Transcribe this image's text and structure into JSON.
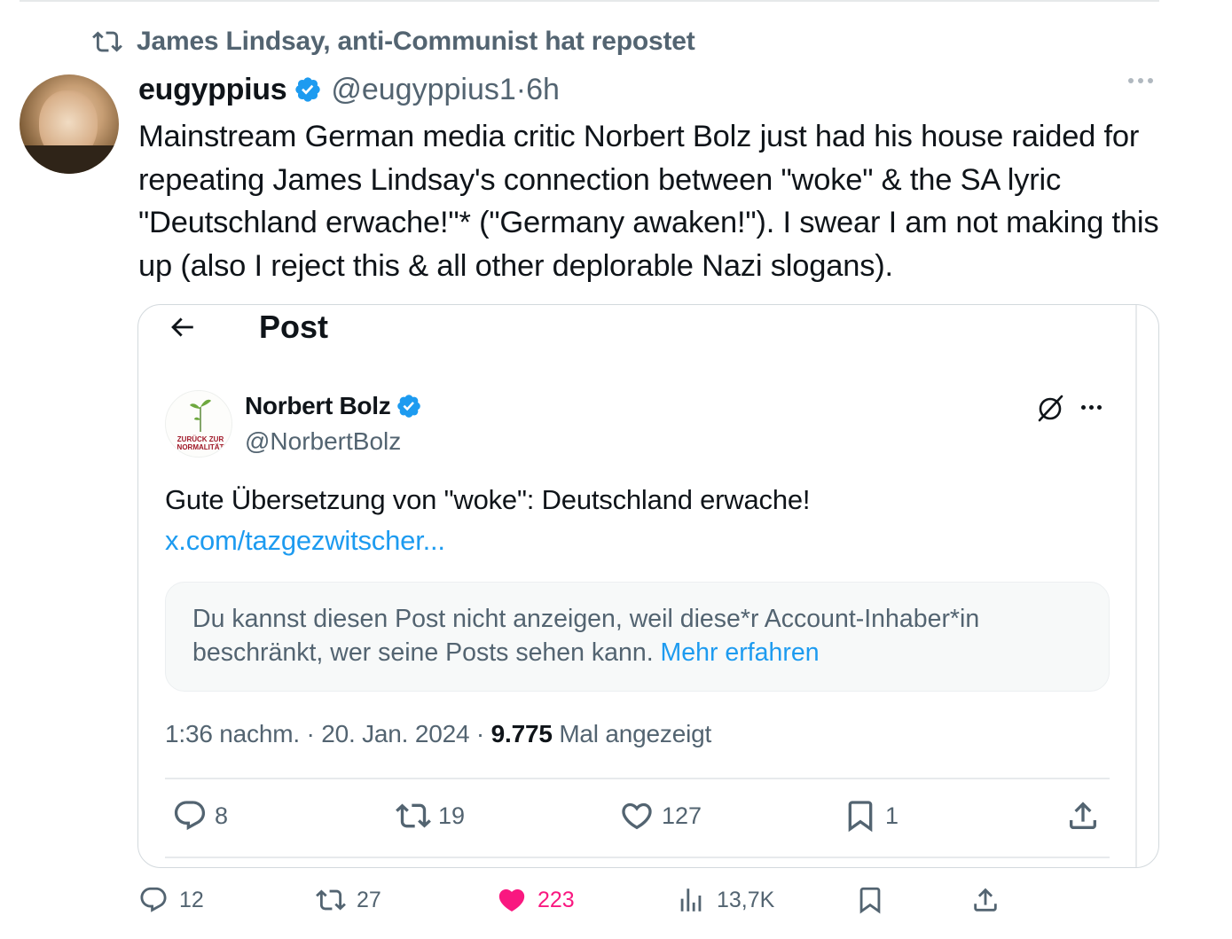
{
  "repost": {
    "label": "James Lindsay, anti-Communist hat repostet"
  },
  "author": {
    "name": "eugyppius",
    "handle": "@eugyppius1",
    "time": "6h"
  },
  "tweet": {
    "text": "Mainstream German media critic Norbert Bolz just had his house raided for repeating James Lindsay's connection between \"woke\" & the SA lyric \"Deutschland erwache!\"* (\"Germany awaken!\"). I swear I am not making this up (also I reject this & all other deplorable Nazi slogans)."
  },
  "quoted": {
    "screen_title": "Post",
    "name": "Norbert Bolz",
    "handle": "@NorbertBolz",
    "avatar_text": "ZURÜCK ZUR NORMALITÄT",
    "text": "Gute Übersetzung von \"woke\": Deutschland erwache!",
    "link": "x.com/tazgezwitscher...",
    "notice": "Du kannst diesen Post nicht anzeigen, weil diese*r Account-Inhaber*in beschränkt, wer seine Posts sehen kann.",
    "notice_link": "Mehr erfahren",
    "time": "1:36 nachm.",
    "date": "20. Jan. 2024",
    "views": "9.775",
    "views_label": "Mal angezeigt",
    "stats": {
      "replies": "8",
      "reposts": "19",
      "likes": "127",
      "bookmarks": "1"
    }
  },
  "stats": {
    "replies": "12",
    "reposts": "27",
    "likes": "223",
    "views": "13,7K"
  },
  "colors": {
    "accent": "#1d9bf0",
    "muted": "#536471",
    "like": "#f91880",
    "text": "#0f1419"
  }
}
